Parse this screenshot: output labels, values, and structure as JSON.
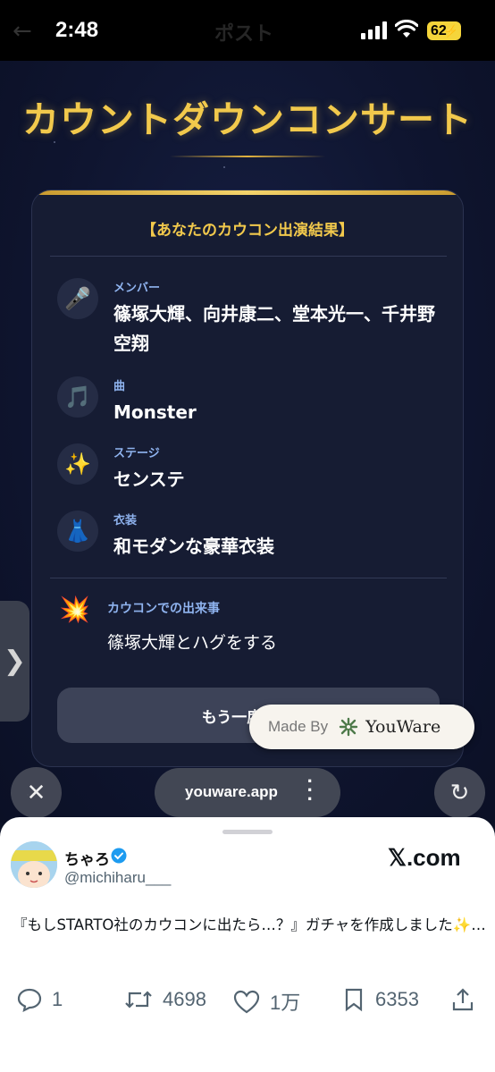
{
  "status_bar": {
    "time": "2:48",
    "page_title": "ポスト",
    "battery": "62"
  },
  "webview": {
    "title": "カウントダウンコンサート",
    "card_header": "【あなたのカウコン出演結果】",
    "items": [
      {
        "icon": "microphone-icon",
        "emoji": "🎤",
        "label": "メンバー",
        "value": "篠塚大輝、向井康二、堂本光一、千井野空翔"
      },
      {
        "icon": "music-notes-icon",
        "emoji": "🎵",
        "label": "曲",
        "value": "Monster"
      },
      {
        "icon": "sparkles-icon",
        "emoji": "✨",
        "label": "ステージ",
        "value": "センステ"
      },
      {
        "icon": "dress-icon",
        "emoji": "👗",
        "label": "衣装",
        "value": "和モダンな豪華衣装"
      }
    ],
    "event": {
      "icon": "explosion-icon",
      "emoji": "💥",
      "label": "カウコンでの出来事",
      "value": "篠塚大輝とハグをする"
    },
    "retry_label": "もう一度回",
    "made_by": {
      "prefix": "Made By",
      "brand": "YouWare"
    }
  },
  "browser": {
    "url": "youware.app",
    "close_symbol": "✕",
    "reload_symbol": "↻",
    "side_tab_symbol": "❯"
  },
  "tweet": {
    "display_name": "ちゃろ",
    "handle": "@michiharu___",
    "source": "𝕏.com",
    "text": "『もしSTARTO社のカウコンに出たら…？』ガチャを作成しました✨…",
    "replies": "1",
    "retweets": "4698",
    "likes": "1万",
    "bookmarks": "6353"
  },
  "colors": {
    "gold": "#f2c94c",
    "label_blue": "#8fb3ef",
    "card_bg": "#161c33"
  }
}
